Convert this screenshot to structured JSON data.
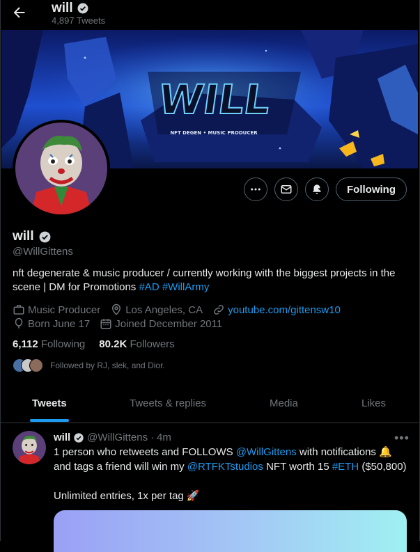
{
  "header": {
    "name": "will",
    "tweet_count": "4,897 Tweets"
  },
  "profile": {
    "name": "will",
    "handle": "@WillGittens",
    "bio_text": "nft degenerate & music producer / currently working with the biggest projects in the scene | DM for Promotions ",
    "bio_tag_1": "#AD",
    "bio_tag_2": "#WillArmy",
    "category": "Music Producer",
    "location": "Los Angeles, CA",
    "website": "youtube.com/gittensw10",
    "birthday": "Born June 17",
    "joined": "Joined December 2011",
    "following_count": "6,112",
    "following_label": "Following",
    "followers_count": "80.2K",
    "followers_label": "Followers",
    "followed_by": "Followed by RJ, slek, and Dior."
  },
  "actions": {
    "follow_label": "Following"
  },
  "banner": {
    "title": "WILL",
    "subtitle": "NFT DEGEN • MUSIC PRODUCER"
  },
  "tabs": [
    {
      "label": "Tweets",
      "active": true
    },
    {
      "label": "Tweets & replies",
      "active": false
    },
    {
      "label": "Media",
      "active": false
    },
    {
      "label": "Likes",
      "active": false
    }
  ],
  "tweet": {
    "name": "will",
    "handle": "@WillGittens",
    "sep": "·",
    "time": "4m",
    "line1_a": "1 person who retweets and FOLLOWS ",
    "mention_1": "@WillGittens",
    "line1_b": " with notifications 🔔",
    "line2_a": "and tags a friend will win my ",
    "mention_2": "@RTFKTstudios",
    "line2_b": " NFT worth 15 ",
    "hashtag": "#ETH",
    "line2_c": " ($50,800)",
    "line3": "Unlimited entries, 1x per tag 🚀"
  },
  "colors": {
    "accent": "#1d9bf0",
    "background": "#000000",
    "muted": "#71767b",
    "border": "#2f3336"
  },
  "icons": [
    "back-arrow-icon",
    "verified-badge-icon",
    "more-icon",
    "message-icon",
    "notification-bell-icon",
    "briefcase-icon",
    "location-pin-icon",
    "link-icon",
    "balloon-icon",
    "calendar-icon"
  ]
}
